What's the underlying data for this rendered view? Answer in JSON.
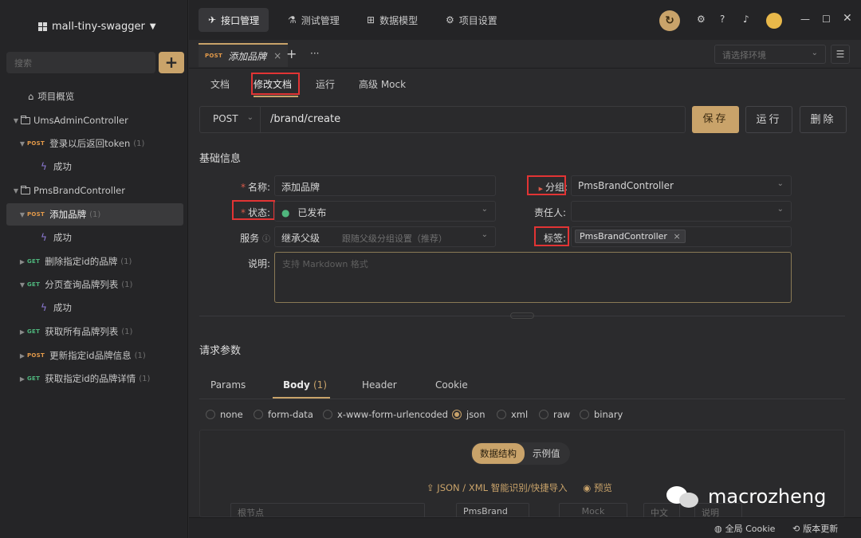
{
  "sidebar": {
    "project_name": "mall-tiny-swagger",
    "search_placeholder": "搜索",
    "add_label": "+",
    "items": [
      {
        "label": "项目概览"
      },
      {
        "label": "UmsAdminController"
      },
      {
        "method": "POST",
        "label": "登录以后返回token",
        "count": "(1)"
      },
      {
        "label": "成功"
      },
      {
        "label": "PmsBrandController"
      },
      {
        "method": "POST",
        "label": "添加品牌",
        "count": "(1)"
      },
      {
        "label": "成功"
      },
      {
        "method": "GET",
        "label": "删除指定id的品牌",
        "count": "(1)"
      },
      {
        "method": "GET",
        "label": "分页查询品牌列表",
        "count": "(1)"
      },
      {
        "label": "成功"
      },
      {
        "method": "GET",
        "label": "获取所有品牌列表",
        "count": "(1)"
      },
      {
        "method": "POST",
        "label": "更新指定id品牌信息",
        "count": "(1)"
      },
      {
        "method": "GET",
        "label": "获取指定id的品牌详情",
        "count": "(1)"
      }
    ]
  },
  "topbar": {
    "tabs": [
      "接口管理",
      "测试管理",
      "数据模型",
      "项目设置"
    ]
  },
  "doctab": {
    "method": "POST",
    "label": "添加品牌",
    "close": "×",
    "add": "+",
    "more": "···"
  },
  "env": {
    "placeholder": "请选择环境",
    "menu": "☰"
  },
  "subtabs": [
    "文档",
    "修改文档",
    "运行",
    "高级 Mock"
  ],
  "request": {
    "method": "POST",
    "path": "/brand/create"
  },
  "buttons": {
    "save": "保存",
    "run": "运行",
    "delete": "删除"
  },
  "basic": {
    "title": "基础信息",
    "name_label": "名称:",
    "name_value": "添加品牌",
    "group_label": "分组:",
    "group_value": "PmsBrandController",
    "status_label": "状态:",
    "status_value": "已发布",
    "owner_label": "责任人:",
    "service_label": "服务",
    "service_value": "继承父级",
    "service_hint": "跟随父级分组设置（推荐）",
    "tag_label": "标签:",
    "tag_value": "PmsBrandController",
    "desc_label": "说明:",
    "desc_placeholder": "支持 Markdown 格式"
  },
  "params": {
    "title": "请求参数",
    "tabs": [
      "Params",
      "Body",
      "Header",
      "Cookie"
    ],
    "body_count": "(1)",
    "body_types": [
      "none",
      "form-data",
      "x-www-form-urlencoded",
      "json",
      "xml",
      "raw",
      "binary"
    ],
    "selected_body_type": "json",
    "segments": [
      "数据结构",
      "示例值"
    ],
    "link_import": "JSON / XML 智能识别/快捷导入",
    "link_preview": "预览",
    "row_cells": [
      "根节点",
      "PmsBrand",
      "Mock",
      "中文名",
      "说明"
    ]
  },
  "watermark": "macrozheng",
  "statusbar": {
    "cookie": "全局 Cookie",
    "update": "版本更新"
  },
  "colors": {
    "accent": "#c9a36a",
    "post": "#e39a4a",
    "get": "#4fb67d",
    "highlight": "#e23434"
  }
}
